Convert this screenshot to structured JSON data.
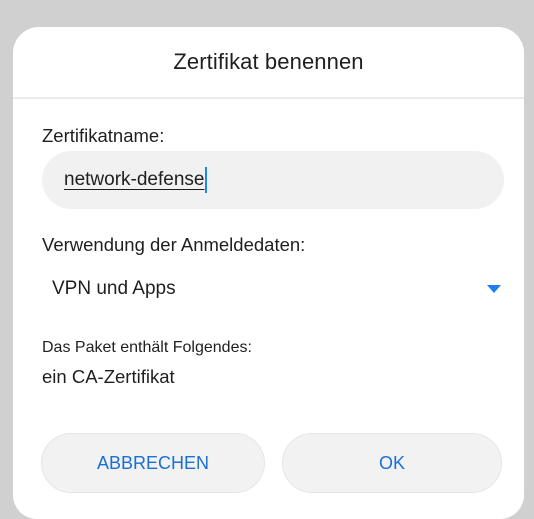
{
  "dialog": {
    "title": "Zertifikat benennen",
    "name_label": "Zertifikatname:",
    "name_value": "network-defense",
    "usage_label": "Verwendung der Anmeldedaten:",
    "usage_value": "VPN und Apps",
    "package_label": "Das Paket enthält Folgendes:",
    "package_value": "ein CA-Zertifikat",
    "cancel_label": "ABBRECHEN",
    "ok_label": "OK"
  },
  "colors": {
    "accent": "#1e7ef0",
    "button_text": "#1a6fd6",
    "field_background": "#f1f1f1",
    "backdrop": "#d0d0d0"
  },
  "icons": {
    "dropdown": "dropdown-arrow-icon"
  }
}
